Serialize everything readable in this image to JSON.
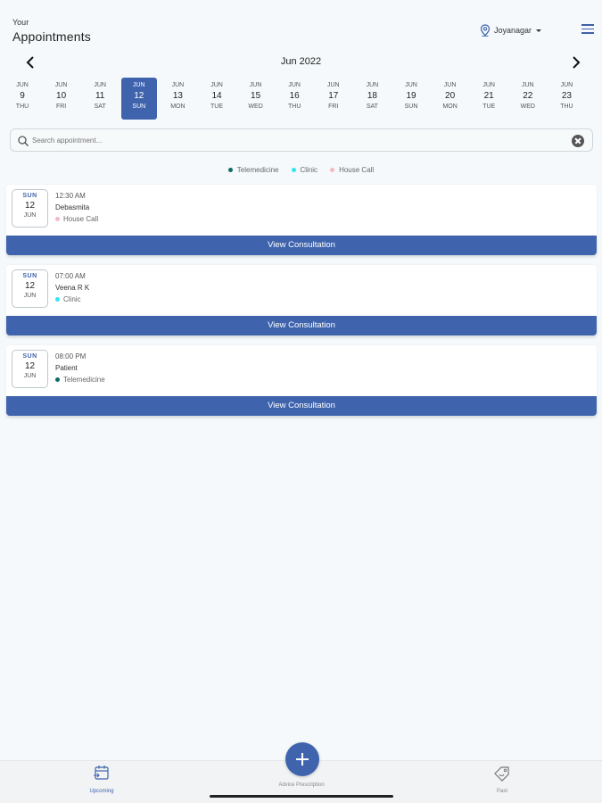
{
  "header": {
    "small": "Your",
    "title": "Appointments",
    "location": "Joyanagar"
  },
  "calendar": {
    "month_label": "Jun 2022",
    "days": [
      {
        "month": "JUN",
        "date": "9",
        "weekday": "THU",
        "selected": false
      },
      {
        "month": "JUN",
        "date": "10",
        "weekday": "FRI",
        "selected": false
      },
      {
        "month": "JUN",
        "date": "11",
        "weekday": "SAT",
        "selected": false
      },
      {
        "month": "JUN",
        "date": "12",
        "weekday": "SUN",
        "selected": true
      },
      {
        "month": "JUN",
        "date": "13",
        "weekday": "MON",
        "selected": false
      },
      {
        "month": "JUN",
        "date": "14",
        "weekday": "TUE",
        "selected": false
      },
      {
        "month": "JUN",
        "date": "15",
        "weekday": "WED",
        "selected": false
      },
      {
        "month": "JUN",
        "date": "16",
        "weekday": "THU",
        "selected": false
      },
      {
        "month": "JUN",
        "date": "17",
        "weekday": "FRI",
        "selected": false
      },
      {
        "month": "JUN",
        "date": "18",
        "weekday": "SAT",
        "selected": false
      },
      {
        "month": "JUN",
        "date": "19",
        "weekday": "SUN",
        "selected": false
      },
      {
        "month": "JUN",
        "date": "20",
        "weekday": "MON",
        "selected": false
      },
      {
        "month": "JUN",
        "date": "21",
        "weekday": "TUE",
        "selected": false
      },
      {
        "month": "JUN",
        "date": "22",
        "weekday": "WED",
        "selected": false
      },
      {
        "month": "JUN",
        "date": "23",
        "weekday": "THU",
        "selected": false
      }
    ]
  },
  "search": {
    "placeholder": "Search appointment..."
  },
  "legend": [
    {
      "label": "Telemedicine",
      "color": "#0e6b63"
    },
    {
      "label": "Clinic",
      "color": "#2ee6f2"
    },
    {
      "label": "House Call",
      "color": "#f4b8c4"
    }
  ],
  "appointments": [
    {
      "weekday": "SUN",
      "date": "12",
      "month": "JUN",
      "time": "12:30 AM",
      "name": "Debasmita",
      "type": "House Call",
      "type_color": "#f4b8c4",
      "action": "View Consultation"
    },
    {
      "weekday": "SUN",
      "date": "12",
      "month": "JUN",
      "time": "07:00 AM",
      "name": "Veena R K",
      "type": "Clinic",
      "type_color": "#2ee6f2",
      "action": "View Consultation"
    },
    {
      "weekday": "SUN",
      "date": "12",
      "month": "JUN",
      "time": "08:00 PM",
      "name": "Patient",
      "type": "Telemedicine",
      "type_color": "#0e6b63",
      "action": "View Consultation"
    }
  ],
  "tabbar": {
    "upcoming": "Upcoming",
    "fab": "Advice Prescription",
    "past": "Past"
  },
  "colors": {
    "accent": "#3f64ad"
  }
}
